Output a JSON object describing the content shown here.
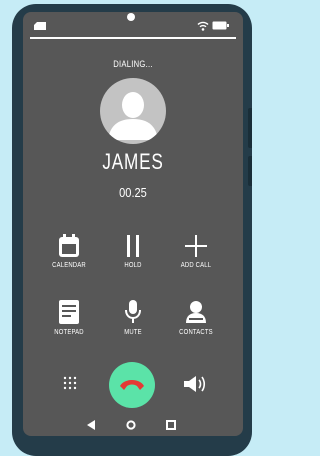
{
  "call": {
    "status": "DIALING...",
    "caller_name": "JAMES",
    "duration": "00.25"
  },
  "controls": {
    "calendar": {
      "label": "CALENDAR",
      "icon": "calendar-icon"
    },
    "hold": {
      "label": "HOLD",
      "icon": "pause-icon"
    },
    "add_call": {
      "label": "ADD CALL",
      "icon": "plus-icon"
    },
    "notepad": {
      "label": "NOTEPAD",
      "icon": "notepad-icon"
    },
    "mute": {
      "label": "MUTE",
      "icon": "microphone-icon"
    },
    "contacts": {
      "label": "CONTACTS",
      "icon": "contacts-icon"
    }
  },
  "bottom_actions": {
    "dialpad_icon": "dialpad-icon",
    "end_call_icon": "phone-hangup-icon",
    "speaker_icon": "speaker-icon"
  },
  "colors": {
    "background": "#c6ecf6",
    "phone_body": "#243c49",
    "screen": "#575757",
    "end_call": "#5be3a8",
    "end_call_icon": "#e53935",
    "avatar": "#c3c3c3"
  }
}
